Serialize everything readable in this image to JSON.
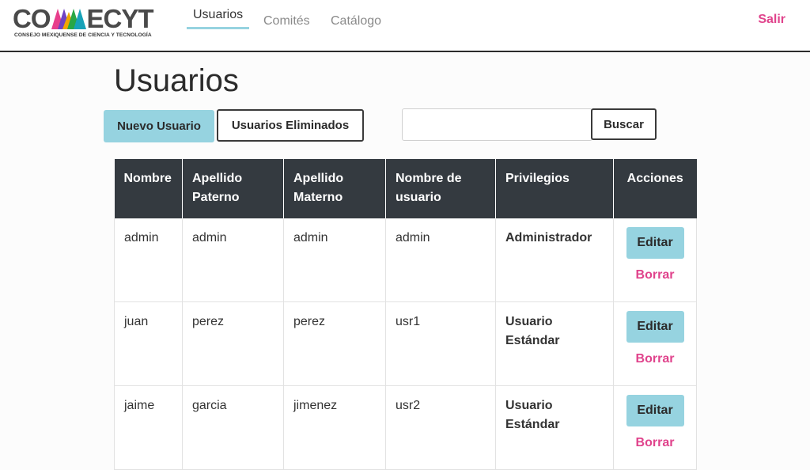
{
  "brand": {
    "logo_left": "CO",
    "logo_right": "ECYT",
    "tagline": "CONSEJO MEXIQUENSE DE CIENCIA Y TECNOLOGÍA"
  },
  "nav": {
    "items": [
      {
        "label": "Usuarios",
        "active": true
      },
      {
        "label": "Comités",
        "active": false
      },
      {
        "label": "Catálogo",
        "active": false
      }
    ],
    "logout_label": "Salir"
  },
  "page": {
    "title": "Usuarios"
  },
  "toolbar": {
    "new_user_label": "Nuevo Usuario",
    "deleted_users_label": "Usuarios Eliminados",
    "search_value": "",
    "search_label": "Buscar"
  },
  "table": {
    "headers": [
      "Nombre",
      "Apellido Paterno",
      "Apellido Materno",
      "Nombre de usuario",
      "Privilegios",
      "Acciones"
    ],
    "rows": [
      {
        "nombre": "admin",
        "paterno": "admin",
        "materno": "admin",
        "usuario": "admin",
        "privilegio": "Administrador",
        "edit": "Editar",
        "delete": "Borrar"
      },
      {
        "nombre": "juan",
        "paterno": "perez",
        "materno": "perez",
        "usuario": "usr1",
        "privilegio": "Usuario Estándar",
        "edit": "Editar",
        "delete": "Borrar"
      },
      {
        "nombre": "jaime",
        "paterno": "garcia",
        "materno": "jimenez",
        "usuario": "usr2",
        "privilegio": "Usuario Estándar",
        "edit": "Editar",
        "delete": "Borrar"
      }
    ]
  },
  "colors": {
    "accent": "#96d3e0",
    "danger_link": "#e0438c",
    "table_header_bg": "#343a40"
  }
}
